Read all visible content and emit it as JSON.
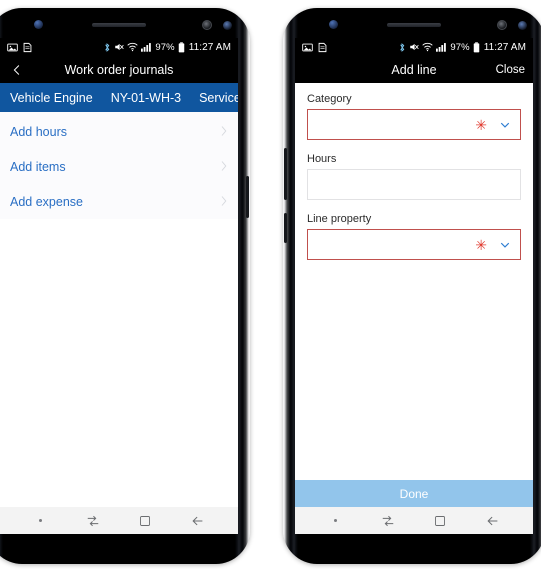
{
  "status_bar": {
    "icons_left": [
      "image-icon",
      "document-icon"
    ],
    "icons_right": [
      "bluetooth-icon",
      "mute-icon",
      "wifi-icon",
      "signal-icon"
    ],
    "battery_percent": "97%",
    "battery_icon": "battery-icon",
    "time": "11:27 AM"
  },
  "left_phone": {
    "app_bar": {
      "back_icon": "back-chevron-icon",
      "title": "Work order journals"
    },
    "banner": {
      "segments": [
        "Vehicle Engine",
        "NY-01-WH-3",
        "Service"
      ],
      "color": "#10569f"
    },
    "list": {
      "items": [
        {
          "label": "Add hours",
          "chevron": "chevron-right-icon"
        },
        {
          "label": "Add items",
          "chevron": "chevron-right-icon"
        },
        {
          "label": "Add expense",
          "chevron": "chevron-right-icon"
        }
      ]
    }
  },
  "right_phone": {
    "app_bar": {
      "title": "Add line",
      "close_label": "Close"
    },
    "form": {
      "fields": [
        {
          "label": "Category",
          "value": "",
          "required": true,
          "required_marker": "✳",
          "dropdown_icon": "chevron-down-icon"
        },
        {
          "label": "Hours",
          "value": "",
          "required": false
        },
        {
          "label": "Line property",
          "value": "",
          "required": true,
          "required_marker": "✳",
          "dropdown_icon": "chevron-down-icon"
        }
      ]
    },
    "done_button": {
      "label": "Done",
      "color": "#92c5eb"
    }
  },
  "nav_bar": {
    "buttons": [
      "dot-indicator",
      "recents-icon",
      "home-square-icon",
      "back-arrow-icon"
    ]
  },
  "colors": {
    "banner_blue": "#10569f",
    "link_blue": "#2a6fc4",
    "required_red": "#c0504d",
    "asterisk_red": "#e03a2f",
    "done_blue": "#92c5eb"
  }
}
